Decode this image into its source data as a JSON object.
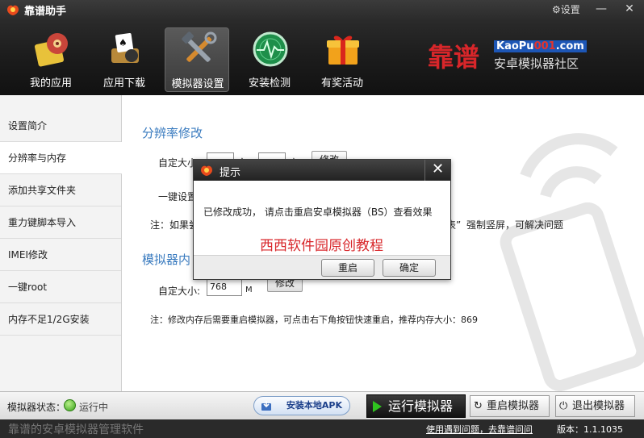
{
  "app": {
    "title": "靠谱助手",
    "settings_label": "设置",
    "minimize": "—",
    "close": "✕"
  },
  "nav": [
    {
      "label": "我的应用",
      "icon": "my-apps-icon",
      "active": false
    },
    {
      "label": "应用下载",
      "icon": "download-icon",
      "active": false
    },
    {
      "label": "模拟器设置",
      "icon": "tools-icon",
      "active": true
    },
    {
      "label": "安装检测",
      "icon": "radar-icon",
      "active": false
    },
    {
      "label": "有奖活动",
      "icon": "gift-icon",
      "active": false
    }
  ],
  "brand": {
    "logo_text": "靠谱",
    "url_prefix": "KaoPu",
    "url_number": "001",
    "url_suffix": ".com",
    "subtitle": "安卓模拟器社区"
  },
  "sidebar": {
    "items": [
      {
        "label": "设置简介"
      },
      {
        "label": "分辨率与内存",
        "active": true
      },
      {
        "label": "添加共享文件夹"
      },
      {
        "label": "重力键脚本导入"
      },
      {
        "label": "IMEI修改"
      },
      {
        "label": "一键root"
      },
      {
        "label": "内存不足1/2G安装"
      }
    ]
  },
  "main": {
    "resolution": {
      "title": "分辨率修改",
      "custom_label": "自定大小",
      "width_unit": "宽",
      "height_unit": "高",
      "modify_button": "修改",
      "oneclick_label": "一键设置",
      "note_prefix": "注：如果尝",
      "note_suffix": "强制竖屏，可解决问题",
      "note_quote": "表”"
    },
    "memory": {
      "title": "模拟器内",
      "custom_label": "自定大小:",
      "value": "768",
      "unit": "M",
      "modify_button": "修改",
      "note": "注：修改内存后需要重启模拟器，可点击右下角按钮快速重启，推荐内存大小：869"
    }
  },
  "dialog": {
    "title": "提示",
    "close": "✕",
    "message": "已修改成功，  请点击重启安卓模拟器（BS）查看效果",
    "watermark": "西西软件园原创教程",
    "restart_button": "重启",
    "ok_button": "确定"
  },
  "statusbar": {
    "label": "模拟器状态：",
    "status": "运行中",
    "install_button": "安装本地APK",
    "run_button": "运行模拟器",
    "restart_button": "重启模拟器",
    "exit_button": "退出模拟器"
  },
  "footer": {
    "slogan": "靠谱的安卓模拟器管理软件",
    "help_link": "使用遇到问题，去靠谱问问",
    "version": "版本：1.1.1035"
  }
}
